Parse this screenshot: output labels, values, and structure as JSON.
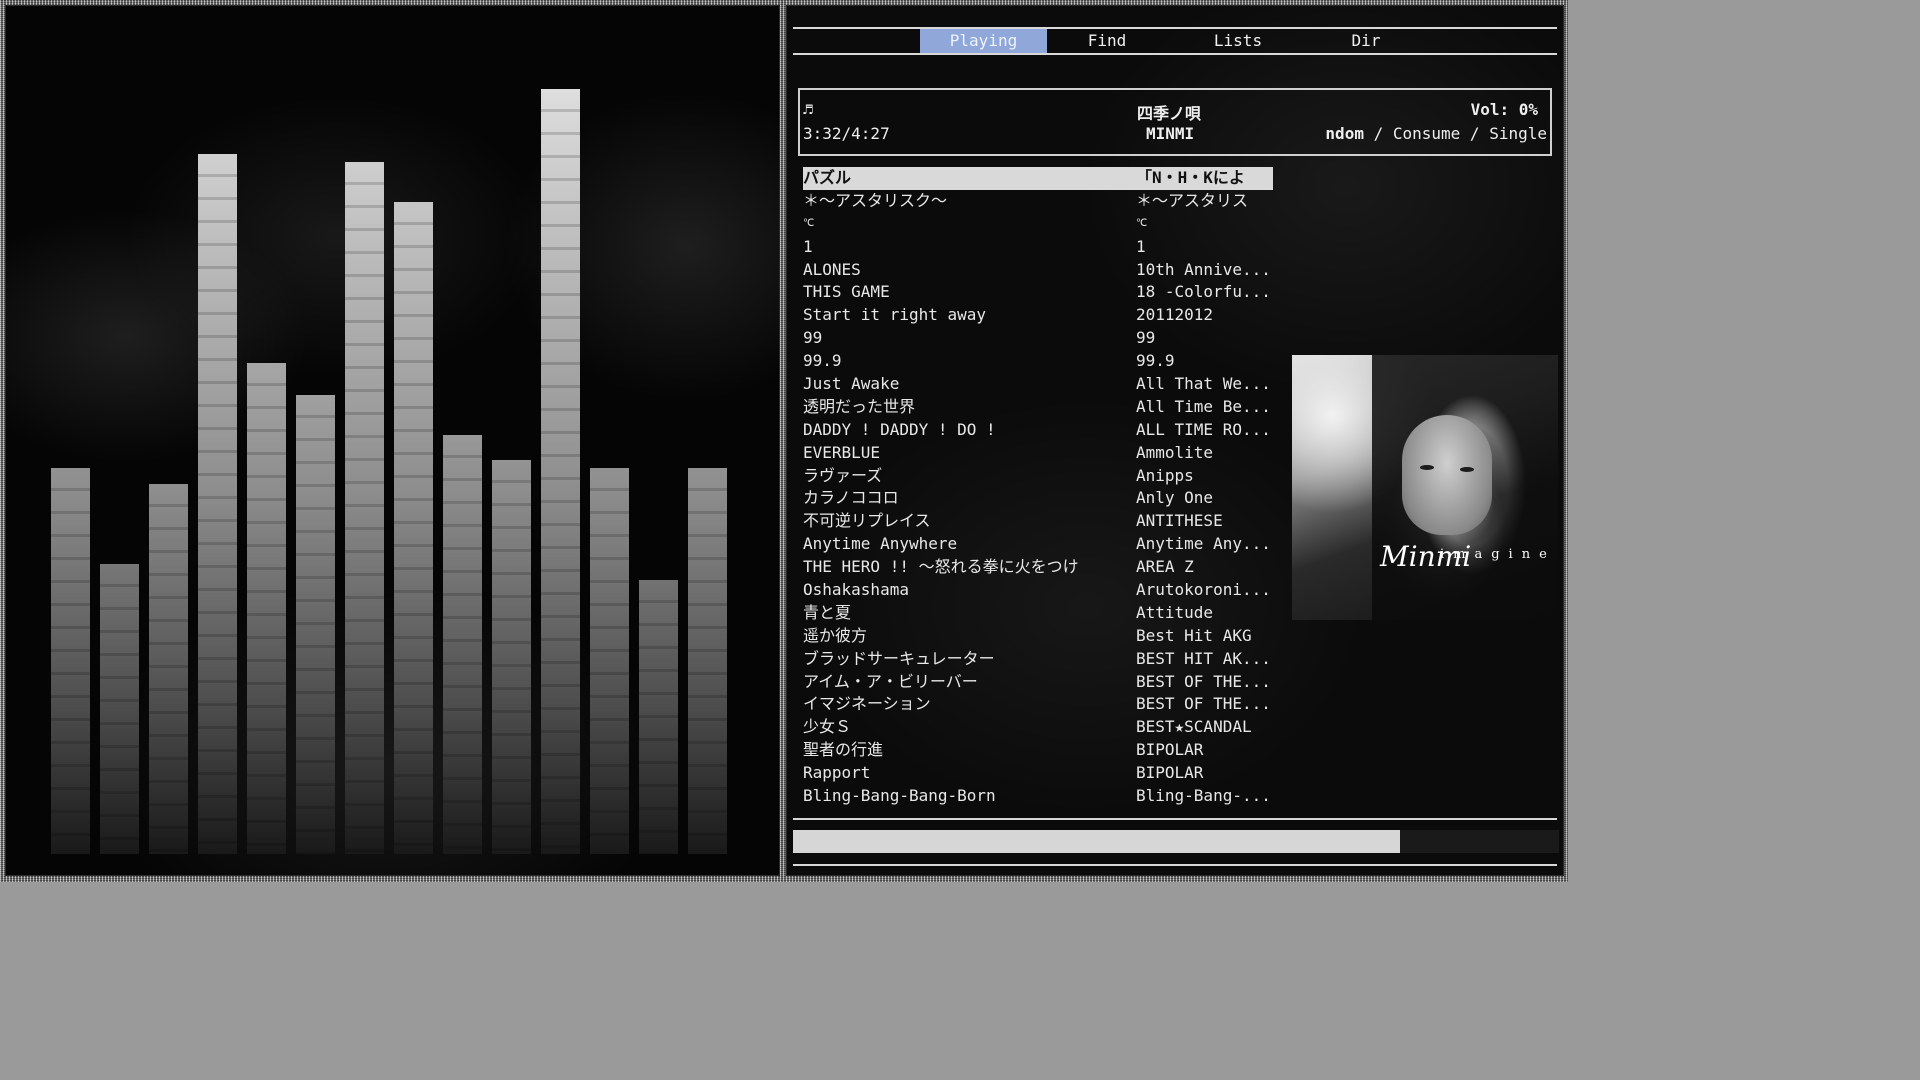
{
  "tabs": [
    {
      "label": "Playing",
      "active": true
    },
    {
      "label": "Find",
      "active": false
    },
    {
      "label": "Lists",
      "active": false
    },
    {
      "label": "Dir",
      "active": false
    }
  ],
  "now_playing": {
    "icon": "music-note-icon",
    "icon_glyph": "♬",
    "elapsed_total": "3:32/4:27",
    "title": "四季ノ唄",
    "artist": "MINMI",
    "volume": "Vol: 0%",
    "mode_random": "ndom",
    "mode_sep1": " / ",
    "mode_consume": "Consume",
    "mode_sep2": " / ",
    "mode_single": "Single"
  },
  "playlist": [
    {
      "title": "パズル",
      "album": "「N・H・Kによ",
      "selected": true
    },
    {
      "title": "＊～アスタリスク～",
      "album": "＊～アスタリス"
    },
    {
      "title": "℃",
      "album": "℃",
      "tiny": true
    },
    {
      "title": "1",
      "album": "1"
    },
    {
      "title": "ALONES",
      "album": "10th Annive..."
    },
    {
      "title": "THIS GAME",
      "album": "18 -Colorfu..."
    },
    {
      "title": "Start it right away",
      "album": "20112012"
    },
    {
      "title": "99",
      "album": "99"
    },
    {
      "title": "99.9",
      "album": "99.9"
    },
    {
      "title": "Just Awake",
      "album": "All That We..."
    },
    {
      "title": "透明だった世界",
      "album": "All Time Be..."
    },
    {
      "title": "DADDY ! DADDY ! DO !",
      "album": "ALL TIME RO..."
    },
    {
      "title": "EVERBLUE",
      "album": "Ammolite"
    },
    {
      "title": "ラヴァーズ",
      "album": "Anipps"
    },
    {
      "title": "カラノココロ",
      "album": "Anly One"
    },
    {
      "title": "不可逆リプレイス",
      "album": "ANTITHESE"
    },
    {
      "title": "Anytime Anywhere",
      "album": "Anytime Any..."
    },
    {
      "title": "THE HERO !! ～怒れる拳に火をつけ",
      "album": "AREA Z"
    },
    {
      "title": "Oshakashama",
      "album": "Arutokoroni..."
    },
    {
      "title": "青と夏",
      "album": "Attitude"
    },
    {
      "title": "遥か彼方",
      "album": "Best Hit AKG"
    },
    {
      "title": "ブラッドサーキュレーター",
      "album": "BEST HIT AK..."
    },
    {
      "title": "アイム・ア・ビリーバー",
      "album": "BEST OF THE..."
    },
    {
      "title": "イマジネーション",
      "album": "BEST OF THE..."
    },
    {
      "title": "少女Ｓ",
      "album": "BEST★SCANDAL"
    },
    {
      "title": "聖者の行進",
      "album": "BIPOLAR"
    },
    {
      "title": "Rapport",
      "album": "BIPOLAR"
    },
    {
      "title": "Bling-Bang-Bang-Born",
      "album": "Bling-Bang-..."
    }
  ],
  "album_art": {
    "signature": "Minmi",
    "word": "imagine"
  },
  "progress": 0.793,
  "visualizer": {
    "levels": [
      0.48,
      0.36,
      0.46,
      0.87,
      0.61,
      0.57,
      0.86,
      0.81,
      0.52,
      0.49,
      0.95,
      0.48,
      0.34,
      0.48
    ]
  },
  "colors": {
    "tab_active": "#8fa7d9",
    "selected_row": "#d9d9d9",
    "progress_fill": "#d6d6d6"
  }
}
